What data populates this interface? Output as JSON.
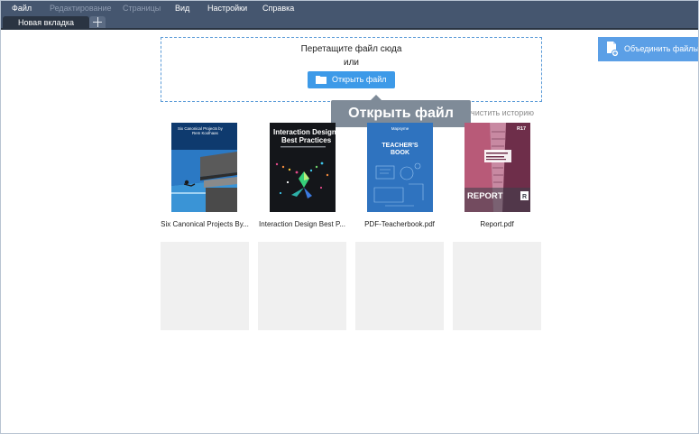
{
  "menu": {
    "items": [
      {
        "label": "Файл",
        "enabled": true
      },
      {
        "label": "Редактирование",
        "enabled": false
      },
      {
        "label": "Страницы",
        "enabled": false
      },
      {
        "label": "Вид",
        "enabled": true
      },
      {
        "label": "Настройки",
        "enabled": true
      },
      {
        "label": "Справка",
        "enabled": true
      }
    ]
  },
  "tabs": {
    "active": "Новая вкладка",
    "add_icon": "plus-icon"
  },
  "dropzone": {
    "line1": "Перетащите файл сюда",
    "line2": "или",
    "open_button": "Открыть файл",
    "open_icon": "folder-icon"
  },
  "merge": {
    "label": "Объединить файлы",
    "icon": "merge-files-icon"
  },
  "tooltip": {
    "label": "Открыть файл"
  },
  "history": {
    "clear_label": "чистить историю"
  },
  "recent_files": [
    {
      "name": "Six Canonical Projects By...",
      "cover_title": "Six Canonical Projects by",
      "cover_author": "Rem Koolhaas"
    },
    {
      "name": "Interaction Design Best P...",
      "cover_title_line1": "Interaction Design",
      "cover_title_line2": "Best Practices"
    },
    {
      "name": "PDF-Teacherbook.pdf",
      "cover_brand": "Mapsyme",
      "cover_title_line1": "TEACHER'S",
      "cover_title_line2": "BOOK"
    },
    {
      "name": "Report.pdf",
      "cover_number": "R17",
      "cover_title": "REPORT",
      "cover_logo": "R"
    }
  ],
  "colors": {
    "menubar": "#45566f",
    "accent": "#3d9ae8",
    "dropzone_border": "#5b9bd8",
    "tooltip": "#7f8b98"
  }
}
